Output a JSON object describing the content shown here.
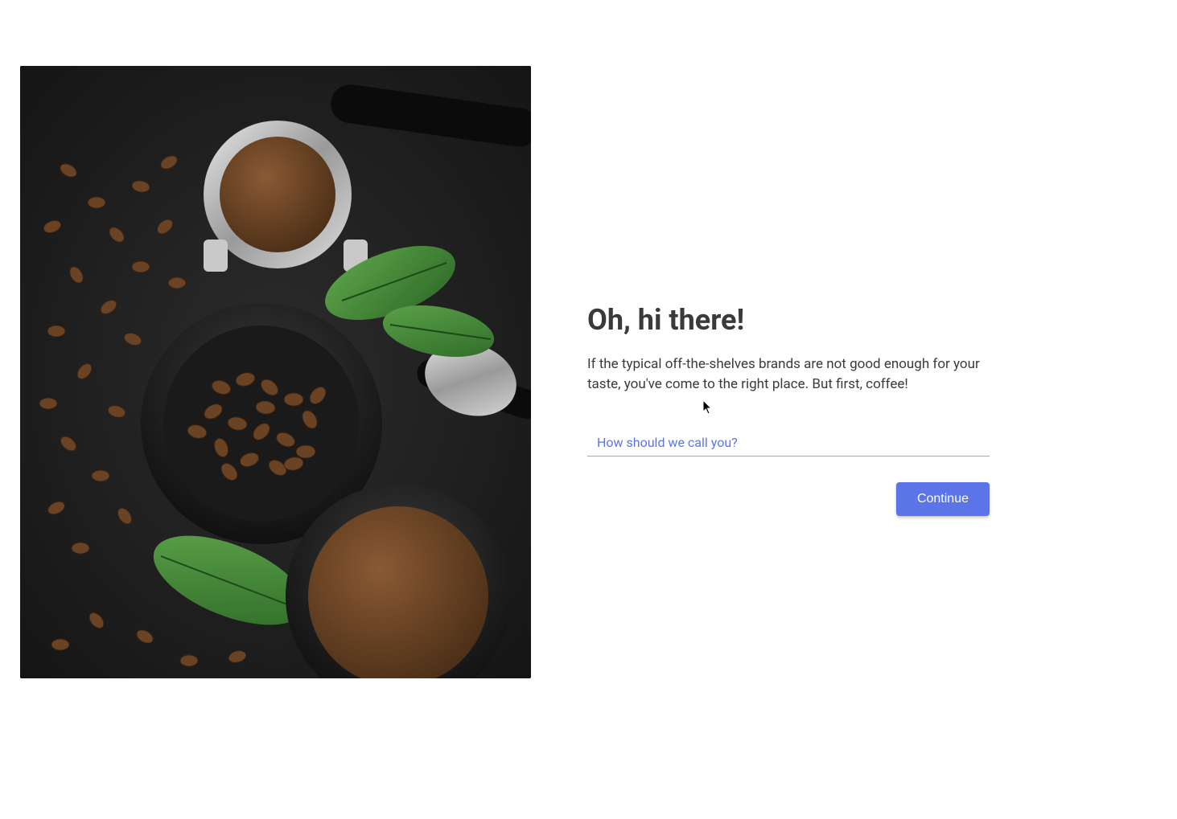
{
  "hero": {
    "alt": "coffee-beans-and-grounds-image"
  },
  "form": {
    "heading": "Oh, hi there!",
    "subtext": "If the typical off-the-shelves brands are not good enough for your taste, you've come to the right place. But first, coffee!",
    "name_field": {
      "label": "How should we call you?",
      "value": ""
    },
    "continue_label": "Continue"
  },
  "colors": {
    "accent": "#5b74e8",
    "text": "#3a3a3a"
  }
}
